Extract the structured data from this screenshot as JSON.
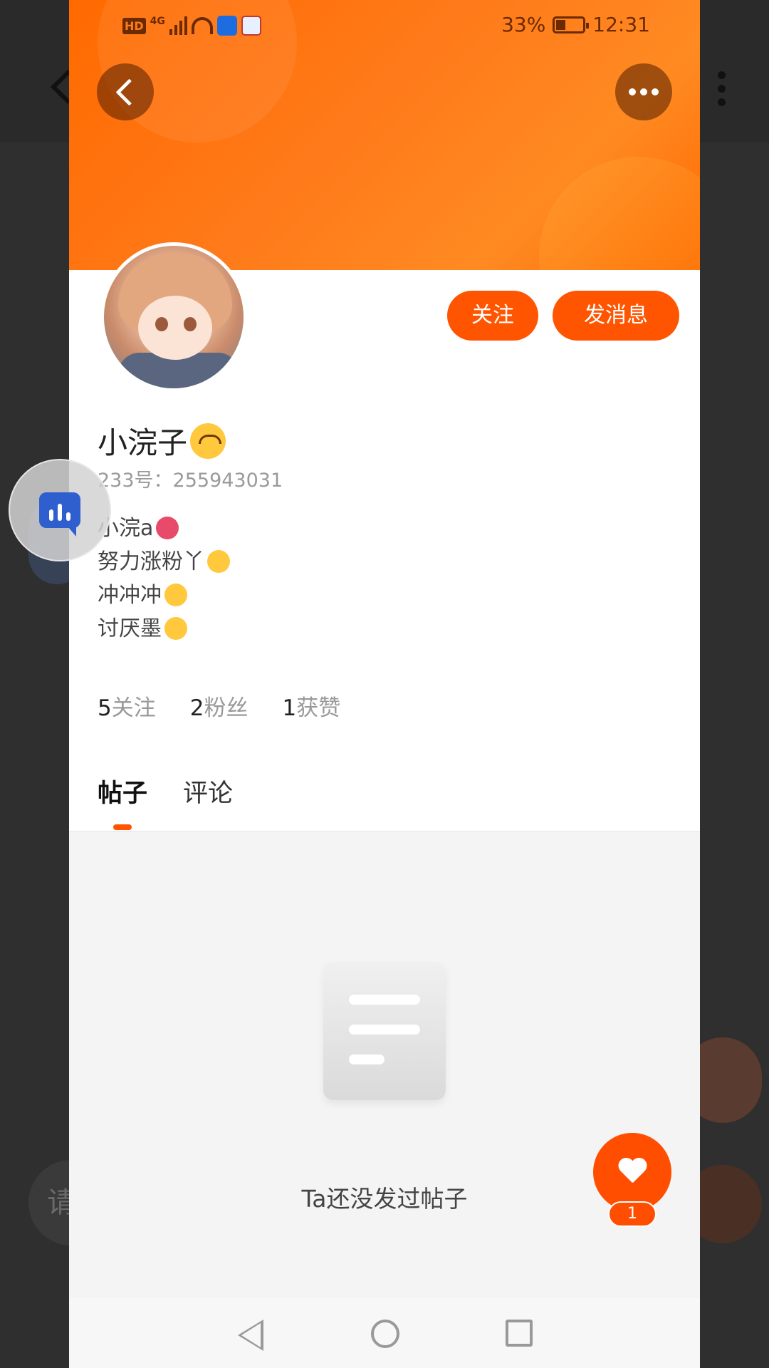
{
  "status_bar": {
    "battery": "33%",
    "time": "12:31",
    "hd_label": "HD",
    "network_label": "4G"
  },
  "header": {
    "back_icon": "back-arrow-icon",
    "more_icon": "more-dots-icon"
  },
  "profile": {
    "follow_label": "关注",
    "message_label": "发消息",
    "name": "小浣子",
    "uid": "233号：255943031",
    "bio": [
      "小浣a",
      "努力涨粉丫",
      "冲冲冲",
      "讨厌墨"
    ],
    "stats": [
      {
        "count": "5",
        "label": "关注"
      },
      {
        "count": "2",
        "label": "粉丝"
      },
      {
        "count": "1",
        "label": "获赞"
      }
    ]
  },
  "tabs": [
    {
      "label": "帖子",
      "active": true
    },
    {
      "label": "评论",
      "active": false
    }
  ],
  "empty_state": {
    "text": "Ta还没发过帖子"
  },
  "like": {
    "count": "1"
  },
  "background": {
    "input_placeholder": "请"
  },
  "colors": {
    "accent": "#ff5500",
    "header_orange": "#ff7a1a"
  }
}
